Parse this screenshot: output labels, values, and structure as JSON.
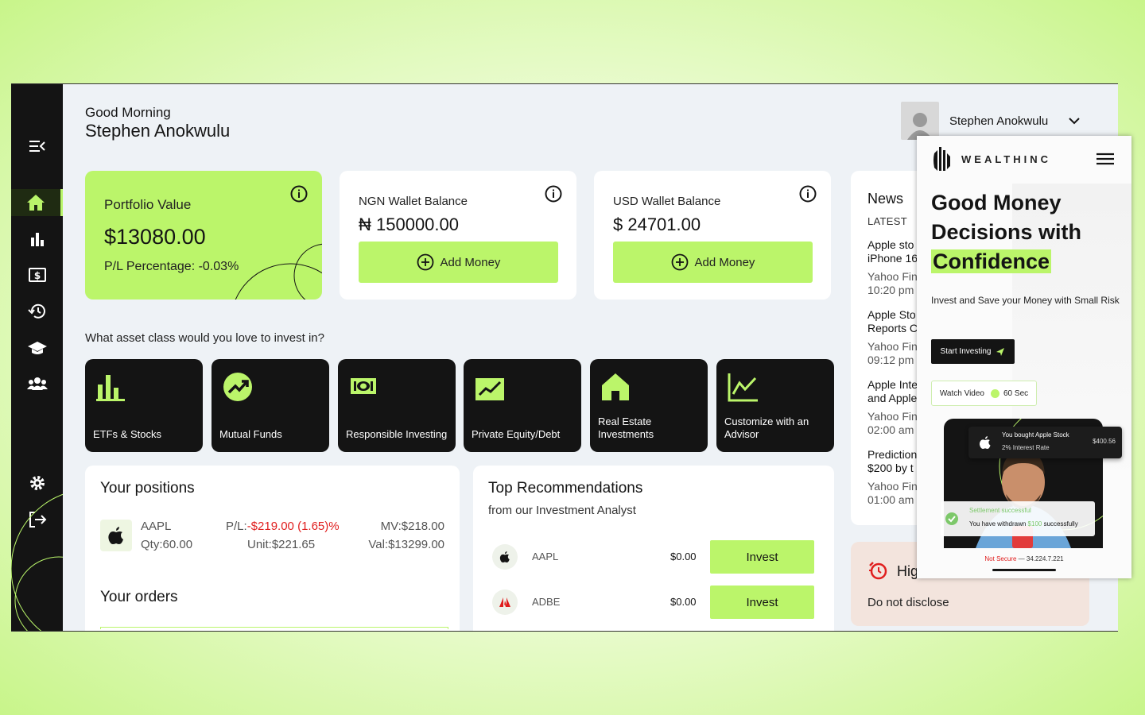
{
  "greeting": {
    "small": "Good Morning",
    "name": "Stephen Anokwulu"
  },
  "user": {
    "name": "Stephen Anokwulu"
  },
  "portfolio": {
    "label": "Portfolio Value",
    "amount": "$13080.00",
    "pl": "P/L Percentage: -0.03%"
  },
  "ngn_wallet": {
    "label": "NGN Wallet Balance",
    "amount": "₦ 150000.00",
    "button": "Add Money"
  },
  "usd_wallet": {
    "label": "USD Wallet Balance",
    "amount": "$ 24701.00",
    "button": "Add Money"
  },
  "asset_question": "What asset class would you love to invest in?",
  "assets": [
    {
      "label": "ETFs & Stocks",
      "icon": "bar-chart-icon"
    },
    {
      "label": "Mutual Funds",
      "icon": "trending-up-icon"
    },
    {
      "label": "Responsible Investing",
      "icon": "cash-icon"
    },
    {
      "label": "Private Equity/Debt",
      "icon": "line-chart-icon"
    },
    {
      "label": "Real Estate Investments",
      "icon": "house-icon"
    },
    {
      "label": "Customize with an Advisor",
      "icon": "stock-chart-icon"
    }
  ],
  "positions": {
    "title": "Your positions",
    "row": {
      "ticker": "AAPL",
      "qty_label": "Qty:",
      "qty": "60.00",
      "pl_label": "P/L:",
      "pl": "-$219.00 (1.65)%",
      "unit_label": "Unit:",
      "unit": "$221.65",
      "mv_label": "MV:",
      "mv": "$218.00",
      "val_label": "Val:",
      "val": "$13299.00"
    }
  },
  "orders": {
    "title": "Your orders"
  },
  "recommendations": {
    "title": "Top Recommendations",
    "subtitle": "from our Investment Analyst",
    "rows": [
      {
        "ticker": "AAPL",
        "price": "$0.00",
        "button": "Invest"
      },
      {
        "ticker": "ADBE",
        "price": "$0.00",
        "button": "Invest"
      }
    ]
  },
  "news": {
    "title": "News",
    "latest": "LATEST",
    "items": [
      {
        "line1": "Apple sto",
        "line2": "iPhone 16",
        "src": "Yahoo Fin",
        "time": "10:20 pm"
      },
      {
        "line1": "Apple Sto",
        "line2": "Reports C",
        "src": "Yahoo Fin",
        "time": "09:12 pm"
      },
      {
        "line1": "Apple Inte",
        "line2": "and Apple",
        "src": "Yahoo Fin",
        "time": "02:00 am"
      },
      {
        "line1": "Prediction",
        "line2": "$200 by t",
        "src": "Yahoo Fin",
        "time": "01:00 am"
      }
    ]
  },
  "alert": {
    "title": "Hig",
    "text": "Do not disclose"
  },
  "mobile": {
    "brand": "WEALTHINC",
    "headline_1": "Good Money",
    "headline_2": "Decisions with",
    "headline_3": "Confidence",
    "tagline": "Invest and Save your Money with Small Risk",
    "start_btn": "Start Investing",
    "watch_label": "Watch Video",
    "watch_time": "60 Sec",
    "toast1_title": "You bought Apple Stock",
    "toast1_sub": "2% Interest Rate",
    "toast1_amount": "$400.56",
    "toast2_title": "Settlement successful",
    "toast2_pre": "You have withdrawn",
    "toast2_amount": "$100",
    "toast2_post": "successfully",
    "addr_warn": "Not Secure",
    "addr_sep": "—",
    "addr_ip": "34.224.7.221"
  },
  "colors": {
    "accent": "#bbf56a",
    "dark": "#141414",
    "negative": "#e01e1e",
    "bg": "#eef2f6"
  }
}
